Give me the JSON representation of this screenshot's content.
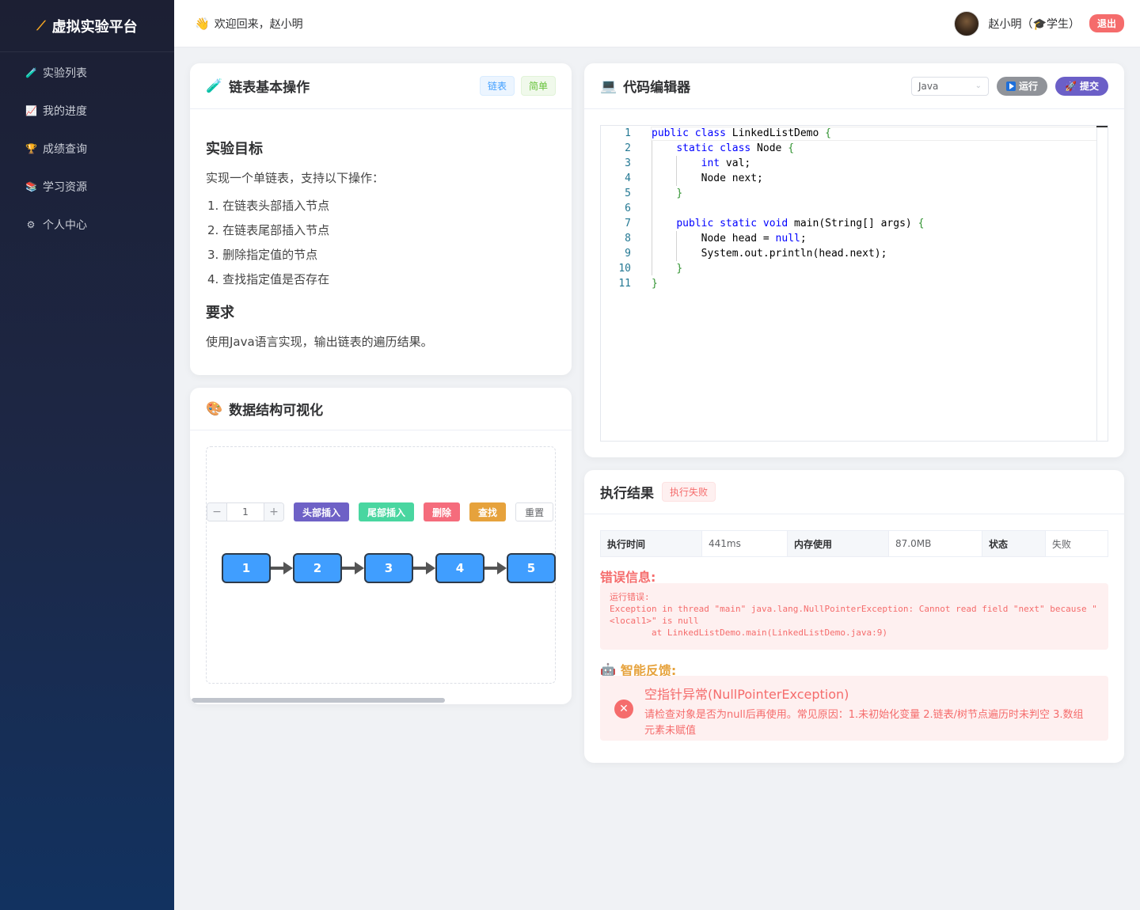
{
  "sidebar": {
    "logo_text": "虚拟实验平台",
    "items": [
      {
        "icon": "test-tube-icon",
        "glyph": "🧪",
        "label": "实验列表"
      },
      {
        "icon": "chart-icon",
        "glyph": "📈",
        "label": "我的进度"
      },
      {
        "icon": "trophy-icon",
        "glyph": "🏆",
        "label": "成绩查询"
      },
      {
        "icon": "books-icon",
        "glyph": "📚",
        "label": "学习资源"
      },
      {
        "icon": "gear-icon",
        "glyph": "⚙",
        "label": "个人中心"
      }
    ]
  },
  "header": {
    "welcome": "欢迎回来，赵小明",
    "user_label": "赵小明（🎓学生）",
    "logout": "退出"
  },
  "experiment": {
    "title": "链表基本操作",
    "tags": [
      "链表",
      "简单"
    ],
    "goal_heading": "实验目标",
    "goal_intro": "实现一个单链表，支持以下操作：",
    "steps": [
      "1. 在链表头部插入节点",
      "2. 在链表尾部插入节点",
      "3. 删除指定值的节点",
      "4. 查找指定值是否存在"
    ],
    "req_heading": "要求",
    "req_text": "使用Java语言实现，输出链表的遍历结果。"
  },
  "viz": {
    "title": "数据结构可视化",
    "input_value": "1",
    "buttons": {
      "head": "头部插入",
      "tail": "尾部插入",
      "delete": "删除",
      "find": "查找",
      "reset": "重置"
    },
    "nodes": [
      "1",
      "2",
      "3",
      "4",
      "5"
    ]
  },
  "editor": {
    "title": "代码编辑器",
    "language": "Java",
    "run": "运行",
    "submit": "提交",
    "lines": [
      "1",
      "2",
      "3",
      "4",
      "5",
      "6",
      "7",
      "8",
      "9",
      "10",
      "11"
    ]
  },
  "result": {
    "title": "执行结果",
    "status_tag": "执行失败",
    "table": [
      {
        "key": "执行时间",
        "value": "441ms"
      },
      {
        "key": "内存使用",
        "value": "87.0MB"
      },
      {
        "key": "状态",
        "value": "失败"
      }
    ],
    "error_title": "错误信息:",
    "error_text": "运行错误:\nException in thread \"main\" java.lang.NullPointerException: Cannot read field \"next\" because \"<local1>\" is null\n        at LinkedListDemo.main(LinkedListDemo.java:9)",
    "feedback_title": "智能反馈:",
    "feedback_heading": "空指针异常(NullPointerException)",
    "feedback_text": "请检查对象是否为null后再使用。常见原因：1.未初始化变量 2.链表/树节点遍历时未判空 3.数组元素未赋值"
  }
}
